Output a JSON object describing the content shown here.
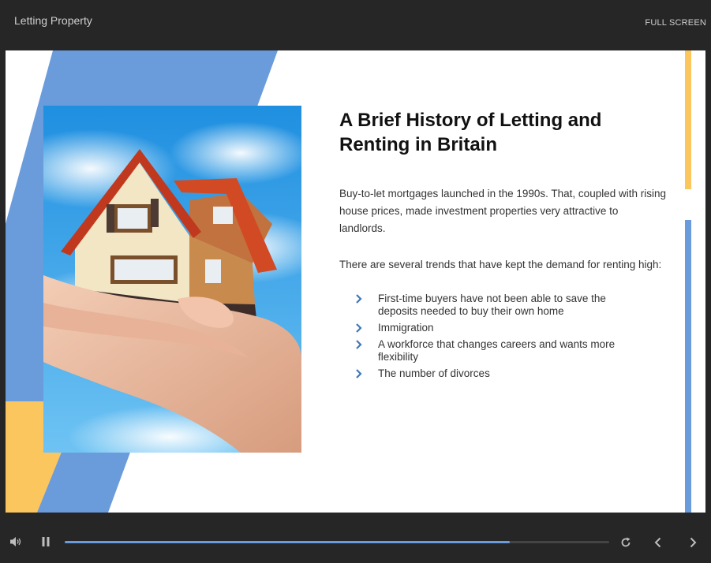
{
  "window": {
    "title": "Letting Property",
    "fullscreen_label": "FULL SCREEN"
  },
  "slide": {
    "heading": "A Brief History of Letting and Renting in Britain",
    "paragraph1": "Buy-to-let mortgages launched in the 1990s. That, coupled with rising house prices, made investment properties very attractive to landlords.",
    "paragraph2": "There are several trends that have kept the demand for renting high:",
    "bullets": [
      "First-time buyers have not been able to save the deposits needed to buy their own home",
      "Immigration",
      "A workforce that changes careers and wants more flexibility",
      "The number of divorces"
    ],
    "image_alt": "Hands holding a model house against a blue sky"
  },
  "colors": {
    "accent_blue": "#6a9bdb",
    "accent_yellow": "#fcc65f",
    "chrome_bg": "#262626"
  },
  "player": {
    "progress_fraction": 0.818,
    "icons": [
      "volume-icon",
      "pause-icon",
      "replay-icon",
      "previous-icon",
      "next-icon"
    ]
  }
}
